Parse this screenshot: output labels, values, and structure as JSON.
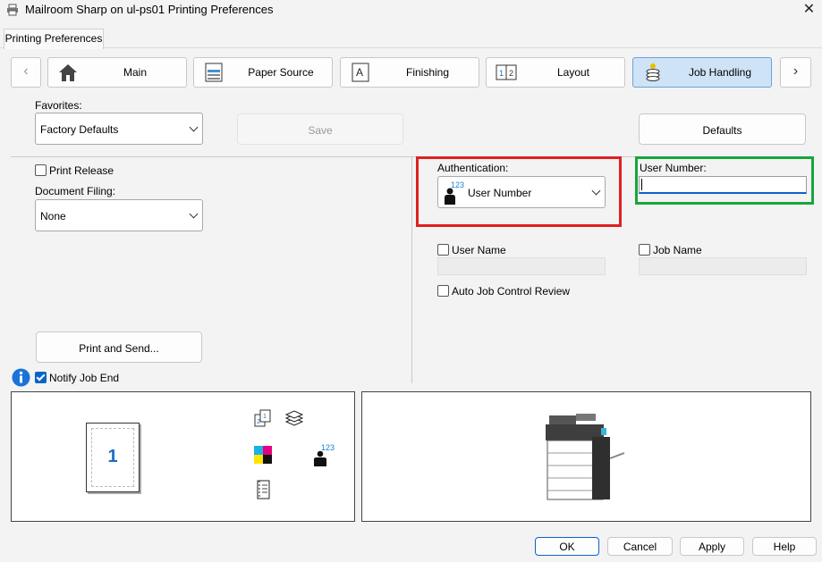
{
  "window": {
    "title": "Mailroom Sharp on ul-ps01 Printing Preferences",
    "close_glyph": "✕"
  },
  "tabs": [
    {
      "label": "Printing Preferences"
    }
  ],
  "nav": {
    "prev": "‹",
    "next": "›",
    "items": [
      {
        "label": "Main",
        "icon": "home-icon"
      },
      {
        "label": "Paper Source",
        "icon": "paper-source-icon"
      },
      {
        "label": "Finishing",
        "icon": "finishing-icon"
      },
      {
        "label": "Layout",
        "icon": "layout-icon"
      },
      {
        "label": "Job Handling",
        "icon": "job-handling-icon",
        "active": true
      }
    ]
  },
  "favorites": {
    "label": "Favorites:",
    "value": "Factory Defaults",
    "save_label": "Save",
    "defaults_label": "Defaults"
  },
  "left": {
    "print_release": {
      "label": "Print Release",
      "checked": false
    },
    "document_filing": {
      "label": "Document Filing:",
      "value": "None"
    },
    "print_and_send": "Print and Send...",
    "notify_job_end": {
      "label": "Notify Job End",
      "checked": true
    }
  },
  "auth": {
    "label": "Authentication:",
    "value": "User Number",
    "icon_number": "123",
    "user_number_label": "User Number:",
    "user_number_value": "",
    "user_name": {
      "label": "User Name",
      "checked": false
    },
    "job_name": {
      "label": "Job Name",
      "checked": false
    },
    "auto_job_control": {
      "label": "Auto Job Control Review",
      "checked": false
    }
  },
  "preview": {
    "page_number": "1",
    "auth_icon_number": "123"
  },
  "footer": {
    "ok": "OK",
    "cancel": "Cancel",
    "apply": "Apply",
    "help": "Help"
  },
  "highlights": {
    "red": "#e02020",
    "green": "#18a53a"
  }
}
